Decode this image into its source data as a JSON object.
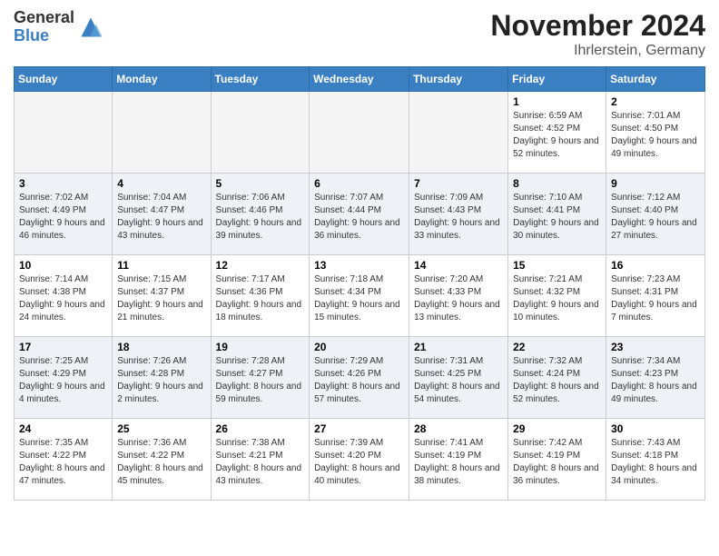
{
  "header": {
    "logo_general": "General",
    "logo_blue": "Blue",
    "title": "November 2024",
    "subtitle": "Ihrlerstein, Germany"
  },
  "days_of_week": [
    "Sunday",
    "Monday",
    "Tuesday",
    "Wednesday",
    "Thursday",
    "Friday",
    "Saturday"
  ],
  "weeks": [
    [
      {
        "day": "",
        "info": ""
      },
      {
        "day": "",
        "info": ""
      },
      {
        "day": "",
        "info": ""
      },
      {
        "day": "",
        "info": ""
      },
      {
        "day": "",
        "info": ""
      },
      {
        "day": "1",
        "info": "Sunrise: 6:59 AM\nSunset: 4:52 PM\nDaylight: 9 hours and 52 minutes."
      },
      {
        "day": "2",
        "info": "Sunrise: 7:01 AM\nSunset: 4:50 PM\nDaylight: 9 hours and 49 minutes."
      }
    ],
    [
      {
        "day": "3",
        "info": "Sunrise: 7:02 AM\nSunset: 4:49 PM\nDaylight: 9 hours and 46 minutes."
      },
      {
        "day": "4",
        "info": "Sunrise: 7:04 AM\nSunset: 4:47 PM\nDaylight: 9 hours and 43 minutes."
      },
      {
        "day": "5",
        "info": "Sunrise: 7:06 AM\nSunset: 4:46 PM\nDaylight: 9 hours and 39 minutes."
      },
      {
        "day": "6",
        "info": "Sunrise: 7:07 AM\nSunset: 4:44 PM\nDaylight: 9 hours and 36 minutes."
      },
      {
        "day": "7",
        "info": "Sunrise: 7:09 AM\nSunset: 4:43 PM\nDaylight: 9 hours and 33 minutes."
      },
      {
        "day": "8",
        "info": "Sunrise: 7:10 AM\nSunset: 4:41 PM\nDaylight: 9 hours and 30 minutes."
      },
      {
        "day": "9",
        "info": "Sunrise: 7:12 AM\nSunset: 4:40 PM\nDaylight: 9 hours and 27 minutes."
      }
    ],
    [
      {
        "day": "10",
        "info": "Sunrise: 7:14 AM\nSunset: 4:38 PM\nDaylight: 9 hours and 24 minutes."
      },
      {
        "day": "11",
        "info": "Sunrise: 7:15 AM\nSunset: 4:37 PM\nDaylight: 9 hours and 21 minutes."
      },
      {
        "day": "12",
        "info": "Sunrise: 7:17 AM\nSunset: 4:36 PM\nDaylight: 9 hours and 18 minutes."
      },
      {
        "day": "13",
        "info": "Sunrise: 7:18 AM\nSunset: 4:34 PM\nDaylight: 9 hours and 15 minutes."
      },
      {
        "day": "14",
        "info": "Sunrise: 7:20 AM\nSunset: 4:33 PM\nDaylight: 9 hours and 13 minutes."
      },
      {
        "day": "15",
        "info": "Sunrise: 7:21 AM\nSunset: 4:32 PM\nDaylight: 9 hours and 10 minutes."
      },
      {
        "day": "16",
        "info": "Sunrise: 7:23 AM\nSunset: 4:31 PM\nDaylight: 9 hours and 7 minutes."
      }
    ],
    [
      {
        "day": "17",
        "info": "Sunrise: 7:25 AM\nSunset: 4:29 PM\nDaylight: 9 hours and 4 minutes."
      },
      {
        "day": "18",
        "info": "Sunrise: 7:26 AM\nSunset: 4:28 PM\nDaylight: 9 hours and 2 minutes."
      },
      {
        "day": "19",
        "info": "Sunrise: 7:28 AM\nSunset: 4:27 PM\nDaylight: 8 hours and 59 minutes."
      },
      {
        "day": "20",
        "info": "Sunrise: 7:29 AM\nSunset: 4:26 PM\nDaylight: 8 hours and 57 minutes."
      },
      {
        "day": "21",
        "info": "Sunrise: 7:31 AM\nSunset: 4:25 PM\nDaylight: 8 hours and 54 minutes."
      },
      {
        "day": "22",
        "info": "Sunrise: 7:32 AM\nSunset: 4:24 PM\nDaylight: 8 hours and 52 minutes."
      },
      {
        "day": "23",
        "info": "Sunrise: 7:34 AM\nSunset: 4:23 PM\nDaylight: 8 hours and 49 minutes."
      }
    ],
    [
      {
        "day": "24",
        "info": "Sunrise: 7:35 AM\nSunset: 4:22 PM\nDaylight: 8 hours and 47 minutes."
      },
      {
        "day": "25",
        "info": "Sunrise: 7:36 AM\nSunset: 4:22 PM\nDaylight: 8 hours and 45 minutes."
      },
      {
        "day": "26",
        "info": "Sunrise: 7:38 AM\nSunset: 4:21 PM\nDaylight: 8 hours and 43 minutes."
      },
      {
        "day": "27",
        "info": "Sunrise: 7:39 AM\nSunset: 4:20 PM\nDaylight: 8 hours and 40 minutes."
      },
      {
        "day": "28",
        "info": "Sunrise: 7:41 AM\nSunset: 4:19 PM\nDaylight: 8 hours and 38 minutes."
      },
      {
        "day": "29",
        "info": "Sunrise: 7:42 AM\nSunset: 4:19 PM\nDaylight: 8 hours and 36 minutes."
      },
      {
        "day": "30",
        "info": "Sunrise: 7:43 AM\nSunset: 4:18 PM\nDaylight: 8 hours and 34 minutes."
      }
    ]
  ]
}
